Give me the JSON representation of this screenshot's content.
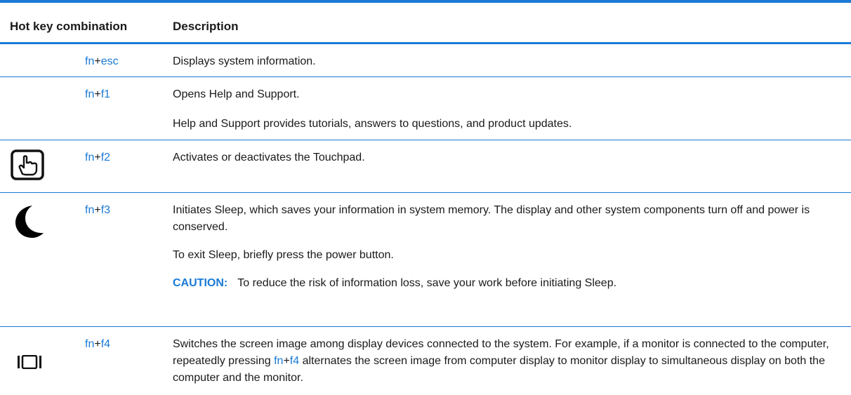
{
  "header": {
    "col1": "Hot key combination",
    "col2": "Description"
  },
  "rows": [
    {
      "icon": "",
      "key1": "fn",
      "plus": "+",
      "key2": "esc",
      "lines": [
        "Displays system information."
      ]
    },
    {
      "icon": "",
      "key1": "fn",
      "plus": "+",
      "key2": "f1",
      "lines": [
        "Opens Help and Support.",
        "Help and Support provides tutorials, answers to questions, and product updates."
      ]
    },
    {
      "icon": "touchpad-icon",
      "key1": "fn",
      "plus": "+",
      "key2": "f2",
      "lines": [
        "Activates or deactivates the Touchpad."
      ]
    },
    {
      "icon": "sleep-moon-icon",
      "key1": "fn",
      "plus": "+",
      "key2": "f3",
      "lines": [
        "Initiates Sleep, which saves your information in system memory. The display and other system components turn off and power is conserved.",
        "To exit Sleep, briefly press the power button."
      ],
      "caution_label": "CAUTION:",
      "caution_text": "To reduce the risk of information loss, save your work before initiating Sleep."
    },
    {
      "icon": "display-switch-icon",
      "key1": "fn",
      "plus": "+",
      "key2": "f4",
      "text_before": "Switches the screen image among display devices connected to the system. For example, if a monitor is connected to the computer, repeatedly pressing ",
      "inline_key1": "fn",
      "inline_plus": "+",
      "inline_key2": "f4",
      "text_after": " alternates the screen image from computer display to monitor display to simultaneous display on both the computer and the monitor."
    }
  ]
}
